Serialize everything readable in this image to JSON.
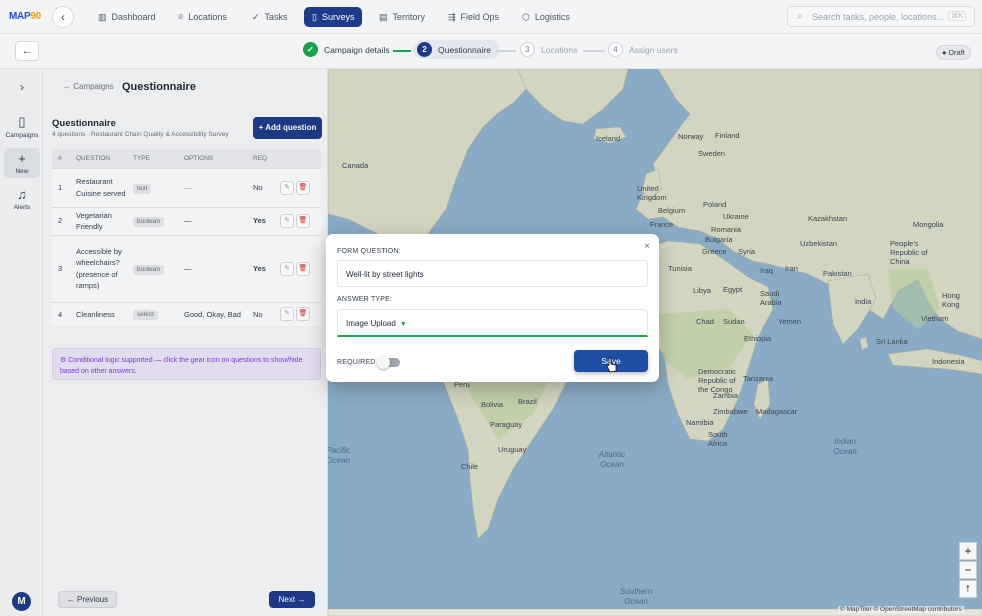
{
  "brand": {
    "logo_text": "MAP",
    "logo_accent": "90",
    "logo_color": "#1d4ed8",
    "accent": "#f59e0b"
  },
  "nav": {
    "items": [
      {
        "label": "Dashboard",
        "icon": "bar-chart-icon"
      },
      {
        "label": "Locations",
        "icon": "location-pin-icon"
      },
      {
        "label": "Tasks",
        "icon": "check-icon"
      },
      {
        "label": "Surveys",
        "icon": "clipboard-icon",
        "active": true
      },
      {
        "label": "Territory",
        "icon": "map-icon"
      },
      {
        "label": "Field Ops",
        "icon": "route-icon"
      },
      {
        "label": "Logistics",
        "icon": "cube-icon"
      }
    ],
    "search_placeholder": "Search tasks, people, locations...",
    "search_shortcut": "⌘K",
    "active_color": "#1e3a8a"
  },
  "steps": {
    "items": [
      {
        "num": "✓",
        "label": "Campaign details",
        "state": "done"
      },
      {
        "num": "2",
        "label": "Questionnaire",
        "state": "current"
      },
      {
        "num": "3",
        "label": "Locations",
        "state": "todo"
      },
      {
        "num": "4",
        "label": "Assign users",
        "state": "todo"
      }
    ],
    "status_badge": "● Draft"
  },
  "rail": {
    "items": [
      {
        "label": "Campaigns",
        "icon": "clipboard-icon"
      },
      {
        "label": "New",
        "icon": "plus-icon"
      },
      {
        "label": "Alerts",
        "icon": "bell-icon"
      }
    ],
    "avatar_initial": "M"
  },
  "panel": {
    "breadcrumb": "← Campaigns",
    "title": "Questionnaire",
    "section_title": "Questionnaire",
    "section_subtitle": "4 questions · Restaurant Chain Quality & Accessibility Survey",
    "add_button": "+ Add question",
    "columns": [
      "#",
      "QUESTION",
      "TYPE",
      "OPTIONS",
      "REQ"
    ],
    "rows": [
      {
        "num": "1",
        "question": "Restaurant Cuisine served",
        "type": "text",
        "options": "—",
        "req": "No"
      },
      {
        "num": "2",
        "question": "Vegetarian Friendly",
        "type": "boolean",
        "options": "—",
        "req": "Yes"
      },
      {
        "num": "3",
        "question": "Accessible by wheelchairs? (presence of ramps)",
        "type": "boolean",
        "options": "—",
        "req": "Yes"
      },
      {
        "num": "4",
        "question": "Cleanliness",
        "type": "select",
        "options": "Good, Okay, Bad",
        "req": "No"
      }
    ],
    "info_text": "⚙ Conditional logic supported — click the gear icon on questions to show/hide based on other answers.",
    "prev_button": "← Previous",
    "next_button": "Next →"
  },
  "map": {
    "labels": {
      "iceland": "Iceland",
      "norway": "Norway",
      "finland": "Finland",
      "sweden": "Sweden",
      "canada": "Canada",
      "uk": "United Kingdom",
      "belgium": "Belgium",
      "poland": "Poland",
      "ukraine": "Ukraine",
      "kazakhstan": "Kazakhstan",
      "mongolia": "Mongolia",
      "france": "France",
      "romania": "Romania",
      "bulgaria": "Bulgaria",
      "uzbekistan": "Uzbekistan",
      "china": "People's Republic of China",
      "greece": "Greece",
      "syria": "Syria",
      "tunisia": "Tunisia",
      "iraq": "Iraq",
      "iran": "Iran",
      "pakistan": "Pakistan",
      "libya": "Libya",
      "egypt": "Egypt",
      "saudi": "Saudi Arabia",
      "india": "India",
      "hongkong": "Hong Kong",
      "chad": "Chad",
      "sudan": "Sudan",
      "yemen": "Yemen",
      "vietnam": "Vietnam",
      "ethiopia": "Ethiopia",
      "srilanka": "Sri Lanka",
      "indonesia": "Indonesia",
      "peru": "Peru",
      "congo": "Democratic Republic of the Congo",
      "tanzania": "Tanzania",
      "bolivia": "Bolivia",
      "brazil": "Brazil",
      "zambia": "Zambia",
      "zimbabwe": "Zimbabwe",
      "madagascar": "Madagascar",
      "paraguay": "Paraguay",
      "namibia": "Namibia",
      "southafrica": "South Africa",
      "uruguay": "Uruguay",
      "chile": "Chile",
      "atlantic": "Atlantic Ocean",
      "indian": "Indian Ocean",
      "pacific": "Pacific Ocean",
      "southern": "Southern Ocean"
    },
    "attribution": "© MapTiler © OpenStreetMap contributors",
    "zoom_in": "+",
    "zoom_out": "−",
    "compass": "⭡"
  },
  "dialog": {
    "question_label": "FORM QUESTION:",
    "question_value": "Well-lit by street lights",
    "answer_type_label": "ANSWER TYPE:",
    "answer_type_value": "Image Upload",
    "required_label": "REQUIRED",
    "required": false,
    "save_button": "Save",
    "close": "×"
  }
}
